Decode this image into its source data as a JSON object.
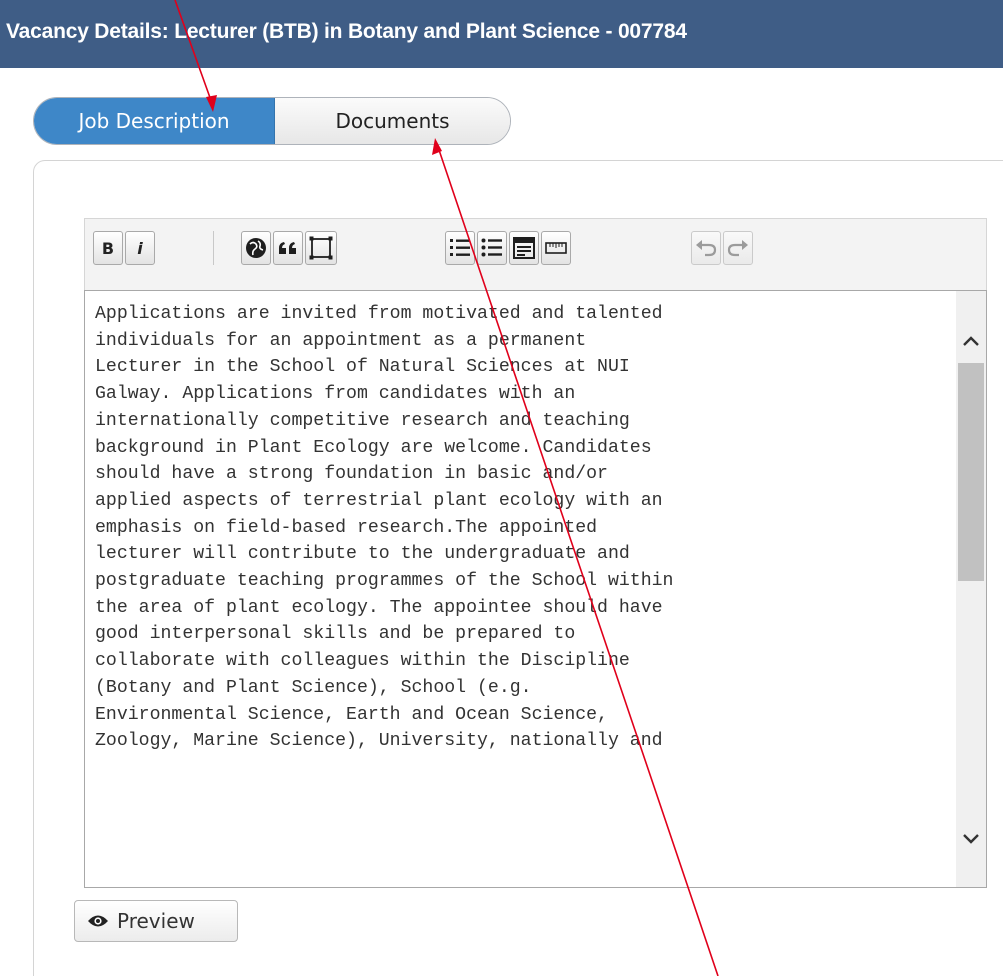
{
  "header": {
    "title": "Vacancy Details: Lecturer (BTB) in Botany and Plant Science - 007784"
  },
  "tabs": [
    {
      "label": "Job Description",
      "active": true
    },
    {
      "label": "Documents",
      "active": false
    }
  ],
  "toolbar": {
    "groups": [
      [
        "bold-icon",
        "italic-icon"
      ],
      [
        "globe-icon",
        "blockquote-icon",
        "image-frame-icon"
      ],
      [
        "ordered-list-icon",
        "unordered-list-icon",
        "table-icon",
        "ruler-icon"
      ],
      [
        "undo-icon",
        "redo-icon"
      ]
    ],
    "bold_label": "B",
    "italic_label": "i"
  },
  "editor": {
    "lines": [
      "Applications are invited from motivated and talented",
      "individuals for an appointment as a permanent",
      "Lecturer in the School of Natural Sciences at NUI",
      "Galway. Applications from candidates with an",
      "internationally competitive research and teaching",
      "background in Plant Ecology are welcome. Candidates",
      "should have a strong foundation in basic and/or",
      "applied aspects of terrestrial plant ecology with an",
      "emphasis on field-based research.The appointed",
      "lecturer will contribute to the undergraduate and",
      "postgraduate teaching programmes of the School within",
      "the area of plant ecology. The appointee should have",
      "good interpersonal skills and be prepared to",
      "collaborate with colleagues within the Discipline",
      "(Botany and Plant Science), School (e.g.",
      "Environmental Science, Earth and Ocean Science,",
      "Zoology, Marine Science), University, nationally and"
    ]
  },
  "preview": {
    "label": "Preview",
    "icon": "eye-icon"
  },
  "colors": {
    "header_bg": "#3f5d86",
    "tab_active_bg": "#3e87c8",
    "annotation_arrow": "#e0001b"
  }
}
